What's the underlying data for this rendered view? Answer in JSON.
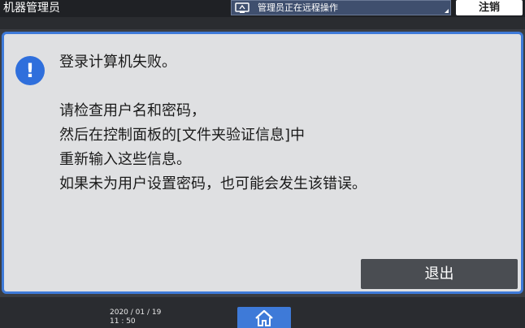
{
  "topbar": {
    "title": "机器管理员",
    "remote_status": "管理员正在远程操作",
    "remote_icon": "remote-monitor-icon",
    "logout_label": "注销"
  },
  "dialog": {
    "icon": "alert-icon",
    "icon_glyph": "!",
    "title": "登录计算机失败。",
    "lines": [
      "请检查用户名和密码，",
      "然后在控制面板的[文件夹验证信息]中",
      "重新输入这些信息。",
      "如果未为用户设置密码，也可能会发生该错误。"
    ],
    "exit_label": "退出"
  },
  "bottombar": {
    "date": "2020 / 01 / 19",
    "time": "11 : 50",
    "home_icon": "home-icon"
  },
  "colors": {
    "accent": "#3e7ad8",
    "dialog_bg": "#dfe0e2",
    "topbar_bg": "#1f2125",
    "button_dark": "#4a4d52"
  }
}
